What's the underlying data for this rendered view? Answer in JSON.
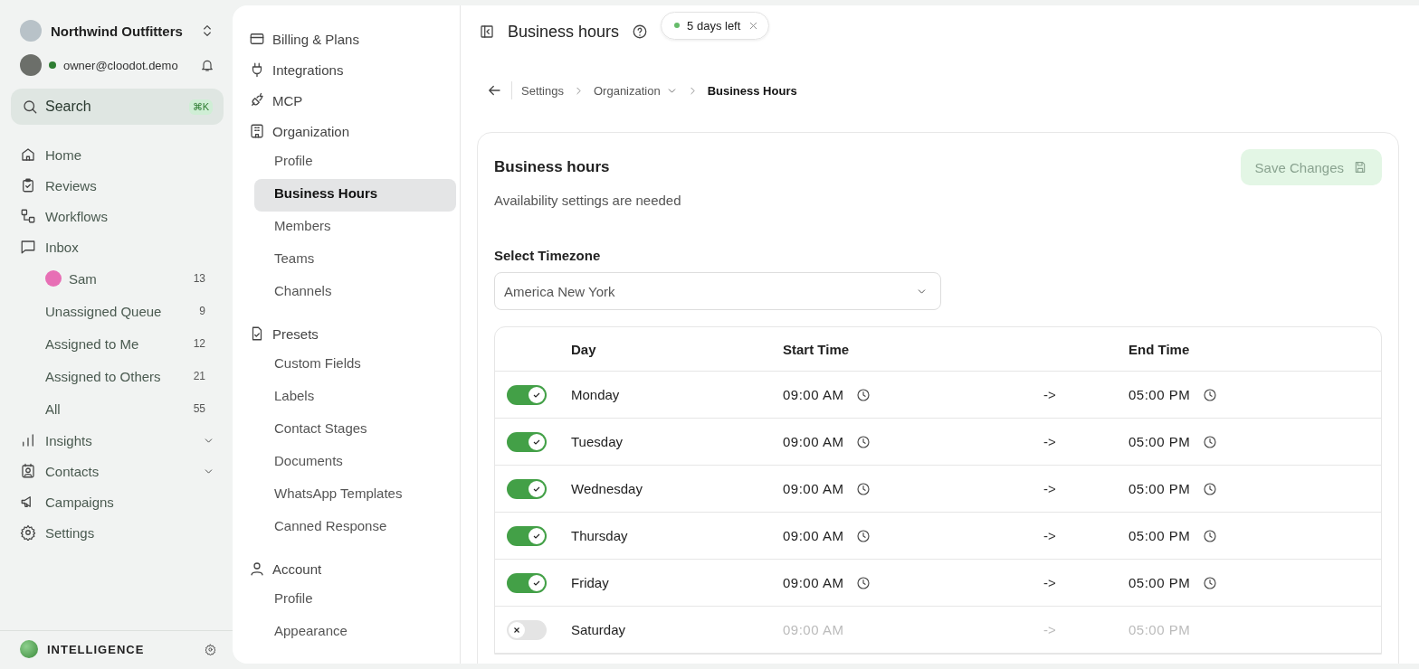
{
  "workspace": {
    "name": "Northwind Outfitters"
  },
  "user": {
    "email": "owner@cloodot.demo",
    "online": true
  },
  "search": {
    "placeholder": "Search",
    "shortcut": "⌘K"
  },
  "nav": [
    {
      "label": "Home",
      "expandable": false
    },
    {
      "label": "Reviews",
      "expandable": false
    },
    {
      "label": "Workflows",
      "expandable": false
    },
    {
      "label": "Inbox",
      "expandable": false,
      "children": [
        {
          "label": "Sam",
          "count": "13",
          "avatar": true
        },
        {
          "label": "Unassigned Queue",
          "count": "9",
          "avatar": false
        },
        {
          "label": "Assigned to Me",
          "count": "12",
          "avatar": false
        },
        {
          "label": "Assigned to Others",
          "count": "21",
          "avatar": false
        },
        {
          "label": "All",
          "count": "55",
          "avatar": false
        }
      ]
    },
    {
      "label": "Insights",
      "expandable": true
    },
    {
      "label": "Contacts",
      "expandable": true
    },
    {
      "label": "Campaigns",
      "expandable": false
    },
    {
      "label": "Settings",
      "expandable": false
    }
  ],
  "footer": {
    "label": "INTELLIGENCE"
  },
  "settings_nav": [
    {
      "label": "Billing & Plans"
    },
    {
      "label": "Integrations"
    },
    {
      "label": "MCP"
    },
    {
      "label": "Organization",
      "children": [
        {
          "label": "Profile",
          "selected": false
        },
        {
          "label": "Business Hours",
          "selected": true
        },
        {
          "label": "Members",
          "selected": false
        },
        {
          "label": "Teams",
          "selected": false
        },
        {
          "label": "Channels",
          "selected": false
        }
      ]
    },
    {
      "label": "Presets",
      "children": [
        {
          "label": "Custom Fields",
          "selected": false
        },
        {
          "label": "Labels",
          "selected": false
        },
        {
          "label": "Contact Stages",
          "selected": false
        },
        {
          "label": "Documents",
          "selected": false
        },
        {
          "label": "WhatsApp Templates",
          "selected": false
        },
        {
          "label": "Canned Response",
          "selected": false
        }
      ]
    },
    {
      "label": "Account",
      "children": [
        {
          "label": "Profile",
          "selected": false
        },
        {
          "label": "Appearance",
          "selected": false
        }
      ]
    }
  ],
  "header": {
    "title": "Business hours",
    "trial_badge": {
      "label": "5 days left",
      "dismissible": true
    }
  },
  "breadcrumb": [
    {
      "label": "Settings",
      "kind": "link"
    },
    {
      "label": "Organization",
      "kind": "dropdown"
    },
    {
      "label": "Business Hours",
      "kind": "current"
    }
  ],
  "card": {
    "title": "Business hours",
    "subtitle": "Availability settings are needed",
    "save_button": {
      "label": "Save Changes",
      "disabled": true
    },
    "timezone": {
      "label": "Select Timezone",
      "value": "America New York"
    },
    "table": {
      "columns": [
        "Day",
        "Start Time",
        "End Time"
      ],
      "rows": [
        {
          "day": "Monday",
          "on": true,
          "start": "09:00 AM",
          "separator": "->",
          "end": "05:00 PM"
        },
        {
          "day": "Tuesday",
          "on": true,
          "start": "09:00 AM",
          "separator": "->",
          "end": "05:00 PM"
        },
        {
          "day": "Wednesday",
          "on": true,
          "start": "09:00 AM",
          "separator": "->",
          "end": "05:00 PM"
        },
        {
          "day": "Thursday",
          "on": true,
          "start": "09:00 AM",
          "separator": "->",
          "end": "05:00 PM"
        },
        {
          "day": "Friday",
          "on": true,
          "start": "09:00 AM",
          "separator": "->",
          "end": "05:00 PM"
        },
        {
          "day": "Saturday",
          "on": false,
          "start": "09:00 AM",
          "separator": "->",
          "end": "05:00 PM"
        }
      ]
    }
  }
}
